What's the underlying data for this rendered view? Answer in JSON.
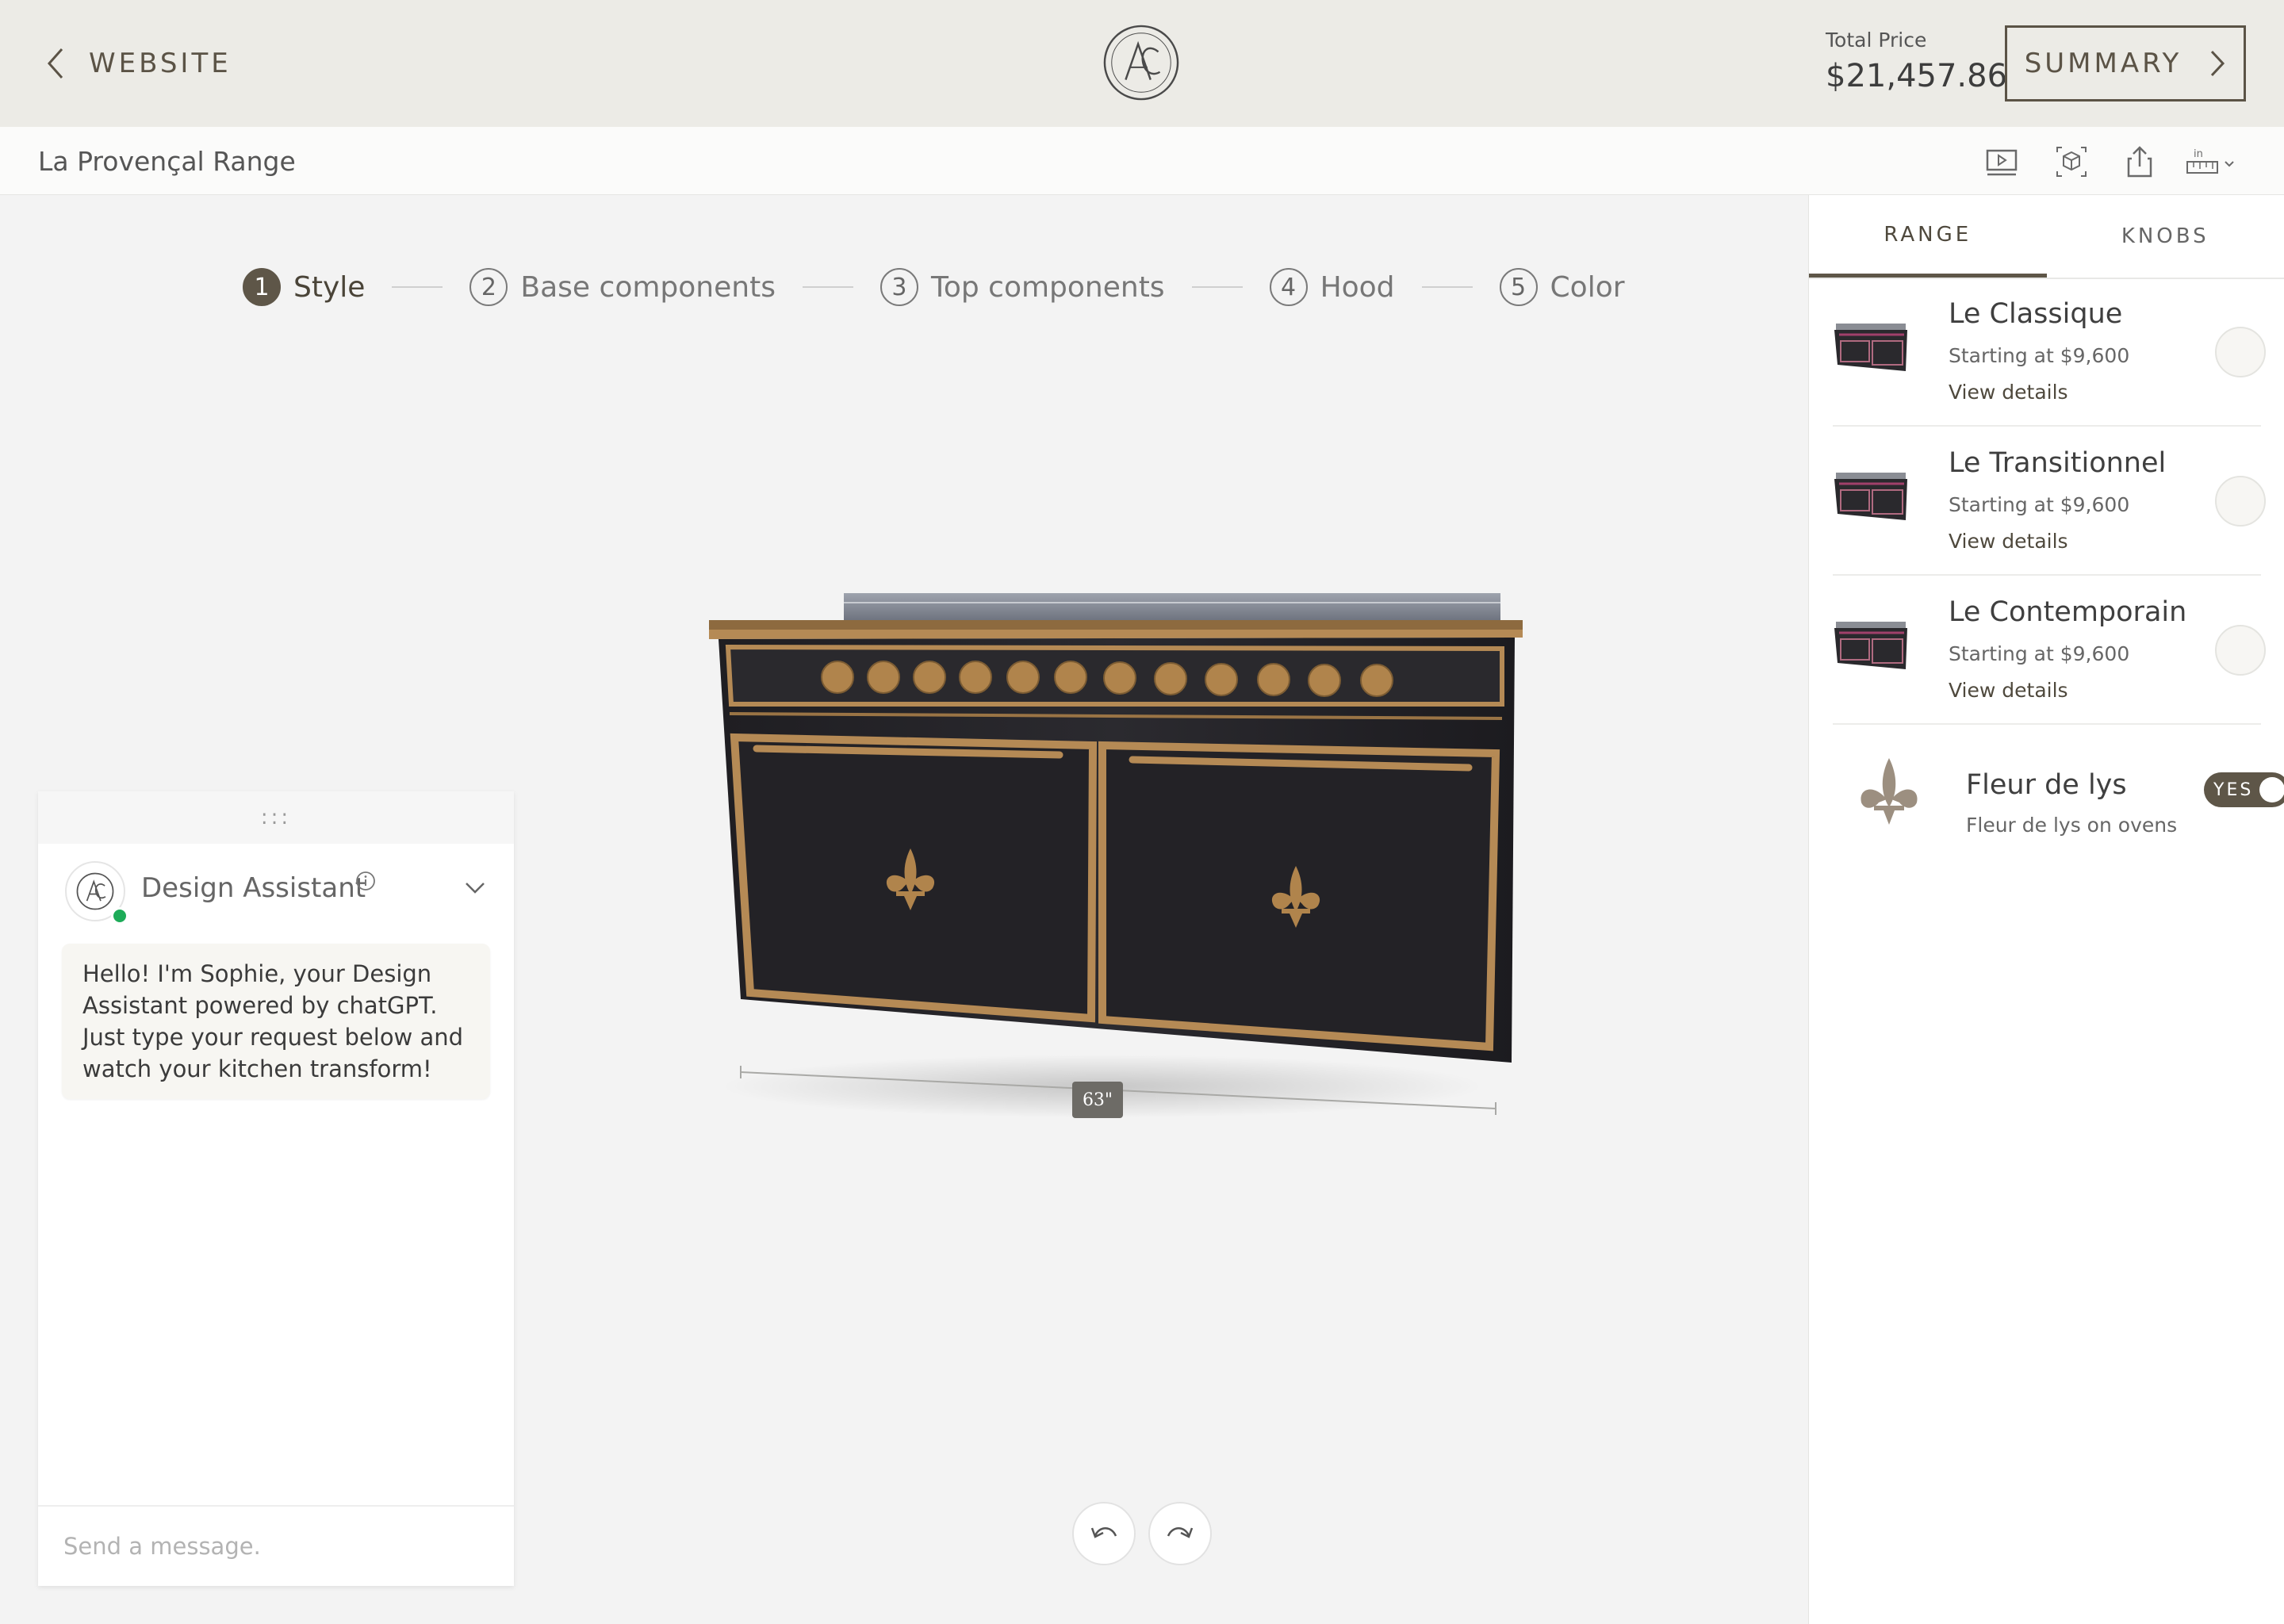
{
  "header": {
    "back_label": "WEBSITE",
    "total_price_label": "Total Price",
    "total_price": "$21,457.86",
    "summary_label": "SUMMARY"
  },
  "subheader": {
    "product_name": "La Provençal Range",
    "tools": [
      "video-icon",
      "3d-view-icon",
      "share-icon",
      "measure-inches-icon"
    ]
  },
  "stepper": [
    {
      "num": "1",
      "label": "Style",
      "active": true
    },
    {
      "num": "2",
      "label": "Base components"
    },
    {
      "num": "3",
      "label": "Top components"
    },
    {
      "num": "4",
      "label": "Hood"
    },
    {
      "num": "5",
      "label": "Color"
    }
  ],
  "stage": {
    "dimension_label": "63\""
  },
  "chat": {
    "drag_handle": ":::",
    "assistant_name": "Design Assistant",
    "greeting": "Hello! I'm Sophie, your Design Assistant powered by chatGPT. Just type your request below and watch your kitchen transform!",
    "input_placeholder": "Send a message."
  },
  "panel": {
    "tabs": [
      "RANGE",
      "KNOBS"
    ],
    "active_tab": "RANGE",
    "options": [
      {
        "name": "Le Classique",
        "price": "Starting at $9,600",
        "link": "View details"
      },
      {
        "name": "Le Transitionnel",
        "price": "Starting at $9,600",
        "link": "View details"
      },
      {
        "name": "Le Contemporain",
        "price": "Starting at $9,600",
        "link": "View details"
      }
    ],
    "fleur": {
      "name": "Fleur de lys",
      "subtitle": "Fleur de lys on ovens",
      "toggle_label": "YES",
      "enabled": true
    }
  },
  "colors": {
    "brand": "#5e5648",
    "brass": "#b58a55",
    "range_body": "#26252a",
    "online": "#1dab58"
  }
}
